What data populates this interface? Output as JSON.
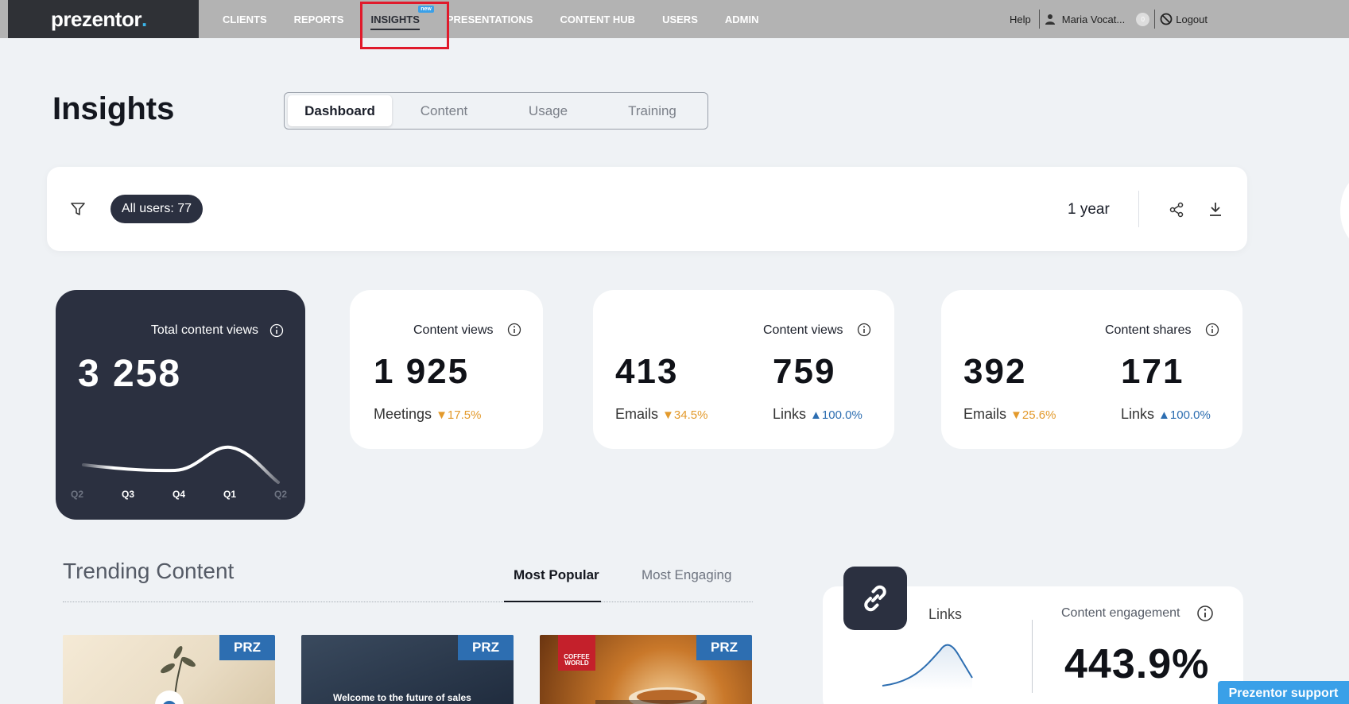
{
  "nav": {
    "logo": "prezentor",
    "logo_dot": ".",
    "items": [
      {
        "label": "CLIENTS"
      },
      {
        "label": "REPORTS"
      },
      {
        "label": "INSIGHTS",
        "badge": "new"
      },
      {
        "label": "PRESENTATIONS"
      },
      {
        "label": "CONTENT HUB"
      },
      {
        "label": "USERS"
      },
      {
        "label": "ADMIN"
      }
    ],
    "help": "Help",
    "user": "Maria Vocat...",
    "notifications": "0",
    "logout": "Logout"
  },
  "header": {
    "title": "Insights",
    "tabs": [
      "Dashboard",
      "Content",
      "Usage",
      "Training"
    ]
  },
  "filter": {
    "users_pill": "All users: 77",
    "period": "1 year"
  },
  "total_card": {
    "label": "Total content views",
    "value": "3 258",
    "quarters": [
      "Q2",
      "Q3",
      "Q4",
      "Q1",
      "Q2"
    ]
  },
  "content_views_card": {
    "label": "Content views",
    "value": "1 925",
    "sub_label": "Meetings",
    "change": "17.5%"
  },
  "content_views_card2": {
    "label": "Content views",
    "emails_value": "413",
    "links_value": "759",
    "emails_label": "Emails",
    "emails_change": "34.5%",
    "links_label": "Links",
    "links_change": "100.0%"
  },
  "content_shares_card": {
    "label": "Content shares",
    "emails_value": "392",
    "links_value": "171",
    "emails_label": "Emails",
    "emails_change": "25.6%",
    "links_label": "Links",
    "links_change": "100.0%"
  },
  "trending": {
    "title": "Trending Content",
    "tabs": [
      "Most Popular",
      "Most Engaging"
    ],
    "thumb_badge": "PRZ",
    "thumb2_caption": "Welcome to the future of sales",
    "thumb3_logo": "COFFEE WORLD"
  },
  "engagement": {
    "links_label": "Links",
    "label": "Content engagement",
    "value": "443.9%"
  },
  "support": "Prezentor support",
  "colors": {
    "dark": "#2b3040",
    "accent_blue": "#2d6eb1",
    "down_orange": "#e39a2c",
    "highlight_red": "#e01a2b"
  }
}
